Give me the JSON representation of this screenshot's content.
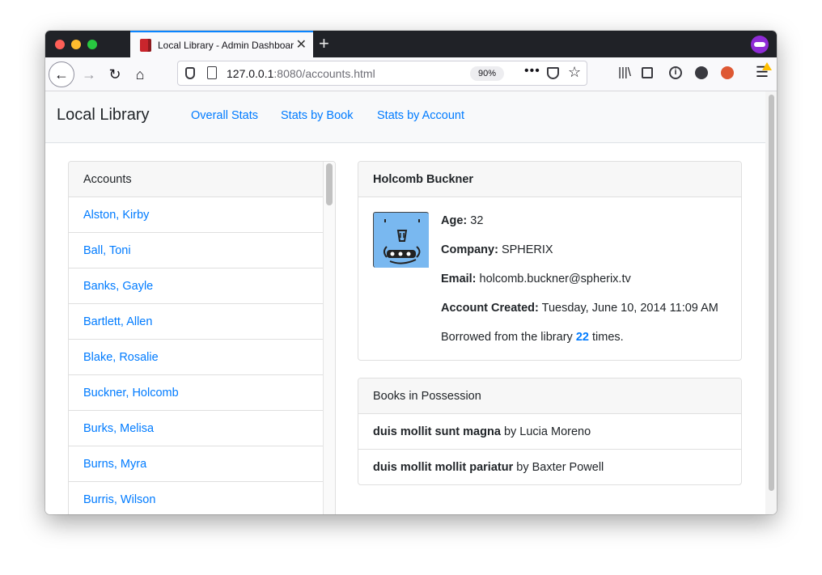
{
  "browser": {
    "tab_title": "Local Library - Admin Dashboard",
    "url_host": "127.0.0.1",
    "url_rest": ":8080/accounts.html",
    "zoom": "90%"
  },
  "site": {
    "brand": "Local Library",
    "nav": [
      "Overall Stats",
      "Stats by Book",
      "Stats by Account"
    ],
    "link_color": "#007bff"
  },
  "accounts": {
    "header": "Accounts",
    "items": [
      "Alston, Kirby",
      "Ball, Toni",
      "Banks, Gayle",
      "Bartlett, Allen",
      "Blake, Rosalie",
      "Buckner, Holcomb",
      "Burks, Melisa",
      "Burns, Myra",
      "Burris, Wilson"
    ]
  },
  "detail": {
    "name": "Holcomb Buckner",
    "age_label": "Age:",
    "age": "32",
    "company_label": "Company:",
    "company": "SPHERIX",
    "email_label": "Email:",
    "email": "holcomb.buckner@spherix.tv",
    "created_label": "Account Created:",
    "created": "Tuesday, June 10, 2014 11:09 AM",
    "borrow_prefix": "Borrowed from the library",
    "borrow_count": "22",
    "borrow_suffix": "times."
  },
  "books": {
    "header": "Books in Possession",
    "by": "by",
    "items": [
      {
        "title": "duis mollit sunt magna",
        "author": "Lucia Moreno"
      },
      {
        "title": "duis mollit mollit pariatur",
        "author": "Baxter Powell"
      }
    ]
  }
}
